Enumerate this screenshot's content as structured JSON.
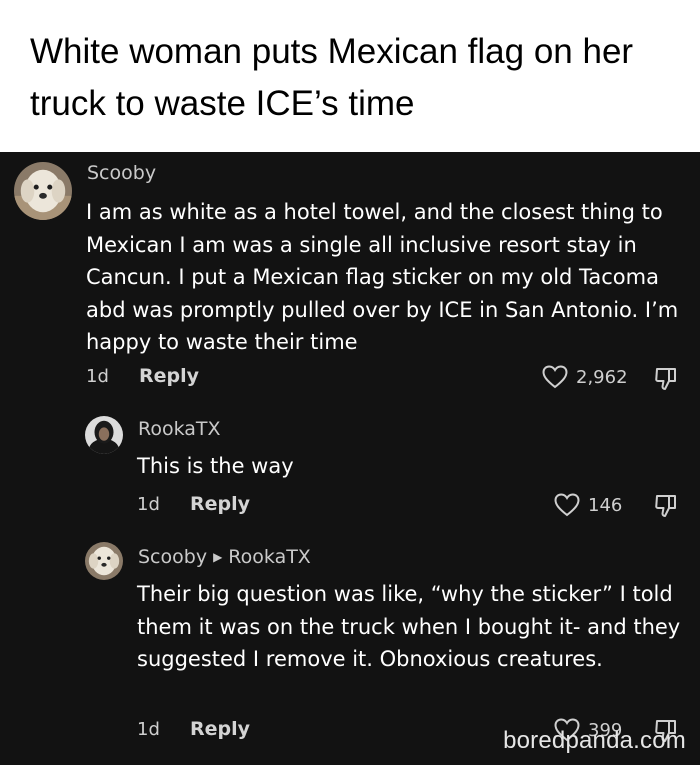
{
  "headline": "White woman puts Mexican flag on her truck to waste ICE’s time",
  "comments": [
    {
      "username": "Scooby",
      "text": "I am as white as a hotel towel, and the closest thing to Mexican I am was a single all inclusive resort stay in Cancun. I put a Mexican flag sticker on my old Tacoma abd was promptly pulled over by ICE in San Antonio. I’m happy to waste their time",
      "age": "1d",
      "reply_label": "Reply",
      "likes": "2,962"
    },
    {
      "username": "RookaTX",
      "text": "This is the way",
      "age": "1d",
      "reply_label": "Reply",
      "likes": "146"
    },
    {
      "username": "Scooby",
      "reply_to": "RookaTX",
      "text": "Their big question was like, “why the sticker” I told them it was on the truck when I bought it- and they suggested I remove it. Obnoxious creatures.",
      "age": "1d",
      "reply_label": "Reply",
      "likes": "399"
    }
  ],
  "watermark": "boredpanda.com",
  "icons": {
    "like": "heart-outline-icon",
    "dislike": "thumb-down-icon"
  },
  "colors": {
    "background": "#121212",
    "title_background": "#ffffff"
  }
}
